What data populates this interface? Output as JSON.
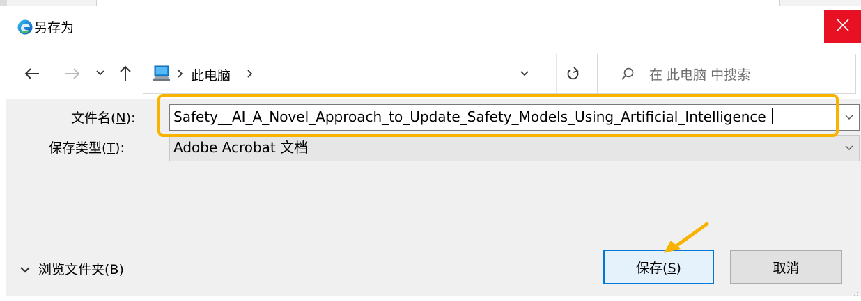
{
  "window": {
    "title": "另存为"
  },
  "nav": {
    "path_segment": "此电脑",
    "search_placeholder": "在 此电脑 中搜索"
  },
  "form": {
    "filename_label": "文件名(N):",
    "filename_mnemonic": "N",
    "filename_value": "Safety__AI_A_Novel_Approach_to_Update_Safety_Models_Using_Artificial_Intelligence",
    "filetype_label": "保存类型(T):",
    "filetype_mnemonic": "T",
    "filetype_value": "Adobe Acrobat 文档"
  },
  "footer": {
    "browse_label": "浏览文件夹(B)",
    "save_label": "保存(S)",
    "cancel_label": "取消"
  },
  "colors": {
    "close_button": "#e81123",
    "highlight": "#f8b300",
    "primary_border": "#0078d7"
  },
  "icons": [
    "edge-icon",
    "close-icon",
    "back-arrow-icon",
    "forward-arrow-icon",
    "recent-chevron-icon",
    "up-arrow-icon",
    "computer-icon",
    "breadcrumb-chevron-icon",
    "address-dropdown-icon",
    "refresh-icon",
    "search-icon",
    "dropdown-icon",
    "expand-chevron-icon",
    "annotation-arrow-icon",
    "resize-grip-icon"
  ]
}
